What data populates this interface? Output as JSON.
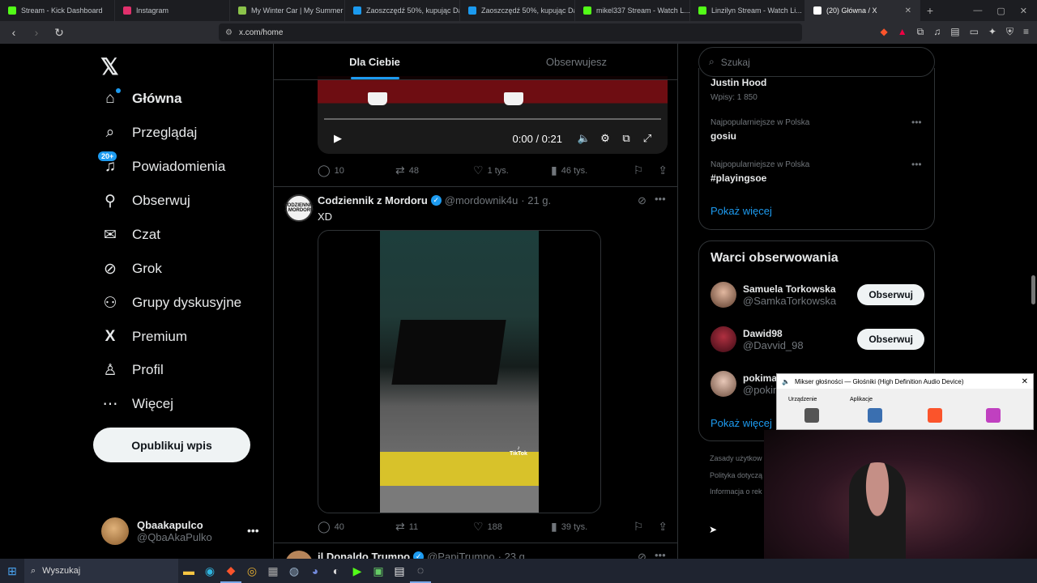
{
  "browser": {
    "tabs": [
      {
        "title": "Stream - Kick Dashboard",
        "color": "#53fc18"
      },
      {
        "title": "Instagram",
        "color": "#e1306c"
      },
      {
        "title": "My Winter Car | My Summer C...",
        "color": "#8bc34a"
      },
      {
        "title": "Zaoszczędź 50%, kupując Dart...",
        "color": "#1b9aef"
      },
      {
        "title": "Zaoszczędź 50%, kupując Dart...",
        "color": "#1b9aef"
      },
      {
        "title": "mikel337 Stream - Watch L...",
        "color": "#53fc18"
      },
      {
        "title": "Linzilyn Stream - Watch Li...",
        "color": "#53fc18"
      },
      {
        "title": "(20) Główna / X",
        "color": "#ffffff",
        "close": "✕"
      }
    ],
    "url": "x.com/home"
  },
  "nav": {
    "items": [
      {
        "label": "Główna",
        "icon": "home-icon",
        "glyph": "⌂"
      },
      {
        "label": "Przeglądaj",
        "icon": "search-icon",
        "glyph": "⌕"
      },
      {
        "label": "Powiadomienia",
        "icon": "bell-icon",
        "glyph": "♫",
        "badge": "20+"
      },
      {
        "label": "Obserwuj",
        "icon": "add-user-icon",
        "glyph": "👤"
      },
      {
        "label": "Czat",
        "icon": "mail-icon",
        "glyph": "✉"
      },
      {
        "label": "Grok",
        "icon": "grok-icon",
        "glyph": "⊘"
      },
      {
        "label": "Grupy dyskusyjne",
        "icon": "groups-icon",
        "glyph": "⚇"
      },
      {
        "label": "Premium",
        "icon": "x-premium-icon",
        "glyph": "X"
      },
      {
        "label": "Profil",
        "icon": "profile-icon",
        "glyph": "♙"
      },
      {
        "label": "Więcej",
        "icon": "more-icon",
        "glyph": "⋯"
      }
    ],
    "post_button": "Opublikuj wpis",
    "me": {
      "name": "Qbaakapulco",
      "handle": "@QbaAkaPulko"
    }
  },
  "feed": {
    "tabs": [
      "Dla Ciebie",
      "Obserwujesz"
    ],
    "video": {
      "time": "0:00 / 0:21"
    },
    "post1_actions": {
      "reply": "10",
      "repost": "48",
      "like": "1 tys.",
      "views": "46 tys."
    },
    "post2": {
      "name": "Codziennik z Mordoru",
      "handle": "@mordownik4u",
      "time": "· 21 g.",
      "text": "XD",
      "avatar_text": "CODZIENNIK Z MORDORU",
      "tiktok": "TikTok",
      "actions": {
        "reply": "40",
        "repost": "11",
        "like": "188",
        "views": "39 tys."
      }
    },
    "post3": {
      "name": "il Donaldo Trumpo",
      "handle": "@PapiTrumpo",
      "time": "· 23 g."
    }
  },
  "right": {
    "search_placeholder": "Szukaj",
    "trends": [
      {
        "kicker": "",
        "title": "Justin Hood",
        "meta": "Wpisy: 1 850"
      },
      {
        "kicker": "Najpopularniejsze w Polska",
        "title": "gosiu"
      },
      {
        "kicker": "Najpopularniejsze w Polska",
        "title": "#playingsoe"
      }
    ],
    "show_more": "Pokaż więcej",
    "follow_title": "Warci obserwowania",
    "follow": [
      {
        "name": "Samuela Torkowska",
        "handle": "@SamkaTorkowska",
        "btn": "Obserwuj"
      },
      {
        "name": "Dawid98",
        "handle": "@Davvid_98",
        "btn": "Obserwuj"
      },
      {
        "name": "pokima",
        "handle": "@pokin"
      }
    ],
    "footer": [
      "Zasady użytkow",
      "Polityka dotyczą",
      "Informacja o rek"
    ]
  },
  "mixer": {
    "title": "Mikser głośności — Głośniki (High Definition Audio Device)",
    "device_label": "Urządzenie",
    "apps_label": "Aplikacje"
  },
  "taskbar": {
    "search": "Wyszukaj"
  }
}
